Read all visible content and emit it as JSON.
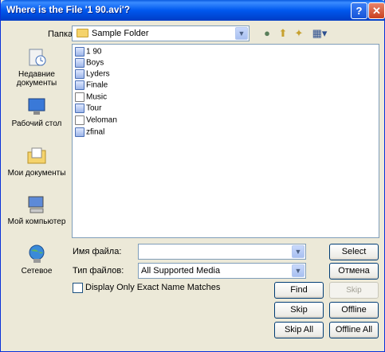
{
  "window": {
    "title": "Where is the File '1 90.avi'?",
    "help_glyph": "?",
    "close_glyph": "✕"
  },
  "lookin": {
    "label": "Папка:",
    "value": "Sample Folder",
    "icon": "folder-icon"
  },
  "toolbar": {
    "icons": [
      "back-icon",
      "up-folder-icon",
      "new-folder-icon",
      "views-menu-icon"
    ]
  },
  "places": [
    {
      "label": "Недавние документы",
      "icon": "recent-documents-icon"
    },
    {
      "label": "Рабочий стол",
      "icon": "desktop-icon"
    },
    {
      "label": "Мои документы",
      "icon": "my-documents-icon"
    },
    {
      "label": "Мой компьютер",
      "icon": "my-computer-icon"
    },
    {
      "label": "Сетевое",
      "icon": "network-icon"
    }
  ],
  "files": [
    {
      "name": "1 90",
      "icon": "video-file-icon"
    },
    {
      "name": "Boys",
      "icon": "video-file-icon"
    },
    {
      "name": "Lyders",
      "icon": "video-file-icon"
    },
    {
      "name": "Finale",
      "icon": "video-file-icon"
    },
    {
      "name": "Music",
      "icon": "media-file-icon"
    },
    {
      "name": "Tour",
      "icon": "video-file-icon"
    },
    {
      "name": "Veloman",
      "icon": "document-file-icon"
    },
    {
      "name": "zfinal",
      "icon": "video-file-icon"
    }
  ],
  "filename": {
    "label": "Имя файла:",
    "value": ""
  },
  "filetype": {
    "label": "Тип файлов:",
    "value": "All Supported Media"
  },
  "buttons": {
    "select": "Select",
    "cancel": "Отмена",
    "find": "Find",
    "skip_previews": "Skip Previews",
    "skip": "Skip",
    "offline": "Offline",
    "skip_all": "Skip All",
    "offline_all": "Offline All"
  },
  "option": {
    "label": "Display Only Exact Name Matches",
    "checked": false
  }
}
